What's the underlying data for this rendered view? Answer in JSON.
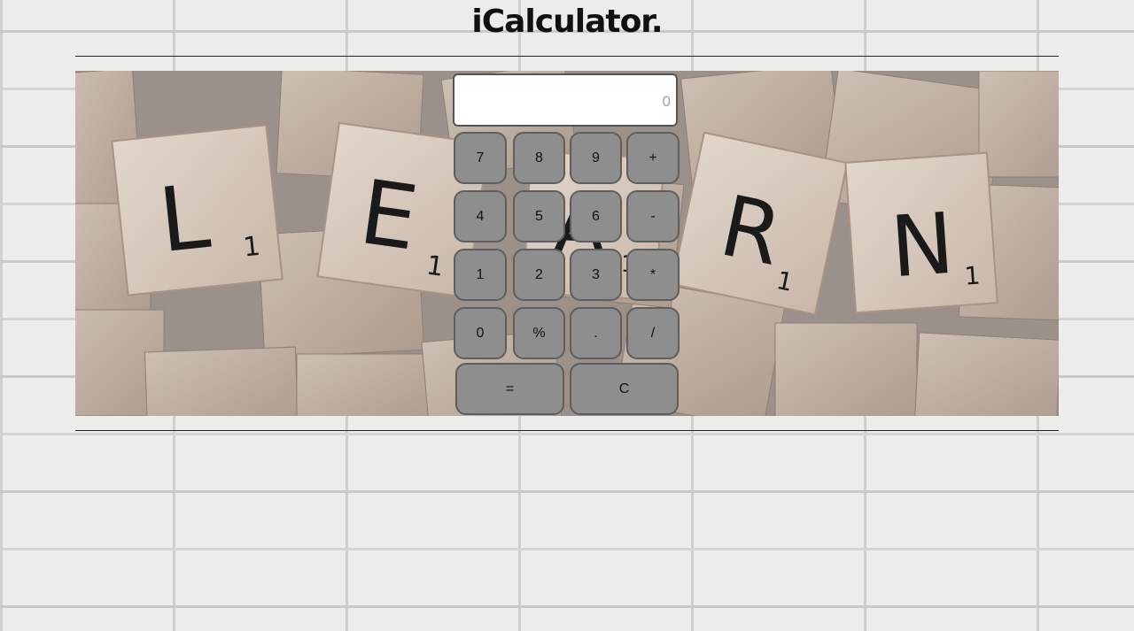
{
  "header": {
    "title": "iCalculator."
  },
  "banner": {
    "tile_letters": [
      "L",
      "E",
      "A",
      "R",
      "N"
    ],
    "tile_points": [
      "1",
      "1",
      "1",
      "1",
      "1"
    ]
  },
  "calculator": {
    "display_value": "0",
    "keys": {
      "k7": "7",
      "k8": "8",
      "k9": "9",
      "plus": "+",
      "k4": "4",
      "k5": "5",
      "k6": "6",
      "minus": "-",
      "k1": "1",
      "k2": "2",
      "k3": "3",
      "multiply": "*",
      "k0": "0",
      "percent": "%",
      "dot": ".",
      "divide": "/",
      "equals": "=",
      "clear": "C"
    }
  },
  "colors": {
    "key_fill": "#8e8e8e",
    "key_border": "#5e5e5e",
    "display_bg": "#ffffff",
    "wall": "#ececea"
  }
}
